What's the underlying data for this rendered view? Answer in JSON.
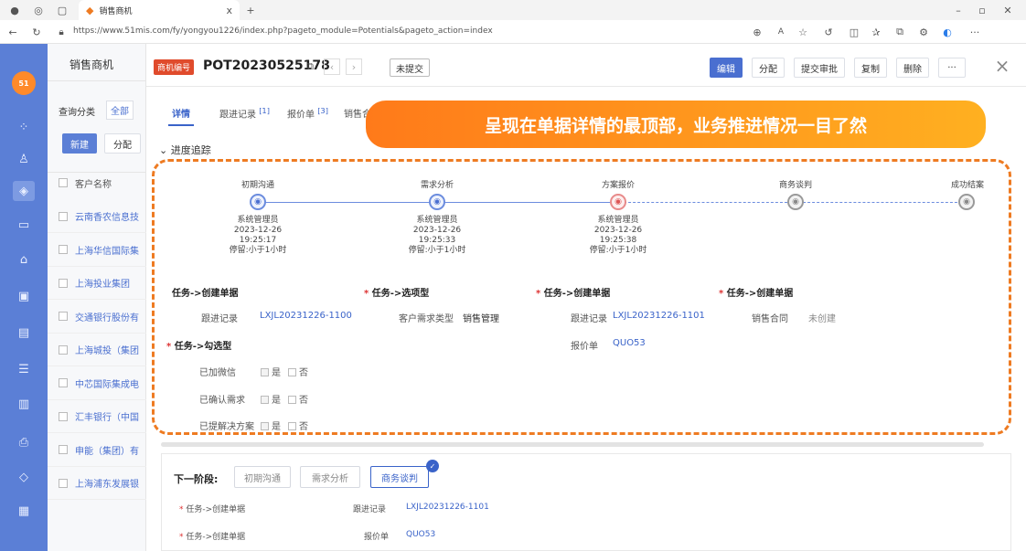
{
  "browser": {
    "tab_title": "销售商机",
    "tab_close": "x",
    "new_tab": "+",
    "url": "https://www.51mis.com/fy/yongyou1226/index.php?pageto_module=Potentials&pageto_action=index"
  },
  "sidebar_icons": [
    "app-logo-icon",
    "grid-icon",
    "users-icon",
    "target-icon",
    "folder-icon",
    "briefcase-icon",
    "bag-icon",
    "monitor-icon",
    "document-icon",
    "board-icon",
    "printer-icon",
    "bookmark-icon",
    "file-icon"
  ],
  "list": {
    "title": "销售商机",
    "filter_label": "查询分类",
    "filter_value": "全部",
    "new_label": "新建",
    "assign_label": "分配",
    "col_header": "客户名称",
    "rows": [
      "云南香农信息技",
      "上海华信国际集",
      "上海投业集团",
      "交通银行股份有",
      "上海城投（集团",
      "中芯国际集成电",
      "汇丰银行（中国",
      "申能（集团）有",
      "上海浦东发展银"
    ]
  },
  "header": {
    "badge": "商机编号",
    "record_id": "POT20230525178",
    "status": "未提交",
    "actions": [
      "编辑",
      "分配",
      "提交审批",
      "复制",
      "删除",
      "···"
    ],
    "close": "×"
  },
  "tabs": [
    {
      "label": "详情"
    },
    {
      "label": "跟进记录",
      "count": "[1]"
    },
    {
      "label": "报价单",
      "count": "[3]"
    },
    {
      "label": "销售合"
    }
  ],
  "callout": "呈现在单据详情的最顶部，业务推进情况一目了然",
  "progress": {
    "section_title": "进度追踪",
    "stages": [
      {
        "name": "初期沟通",
        "user": "系统管理员",
        "date": "2023-12-26",
        "time": "19:25:17",
        "dwell": "停留:小于1小时"
      },
      {
        "name": "需求分析",
        "user": "系统管理员",
        "date": "2023-12-26",
        "time": "19:25:33",
        "dwell": "停留:小于1小时"
      },
      {
        "name": "方案报价",
        "user": "系统管理员",
        "date": "2023-12-26",
        "time": "19:25:38",
        "dwell": "停留:小于1小时"
      },
      {
        "name": "商务谈判",
        "user": "",
        "date": "",
        "time": "",
        "dwell": ""
      },
      {
        "name": "成功结案",
        "user": "",
        "date": "",
        "time": "",
        "dwell": ""
      }
    ]
  },
  "tasks": {
    "t1": {
      "title": "任务->创建单据",
      "field": "跟进记录",
      "value": "LXJL20231226-1100"
    },
    "t2": {
      "title": "任务->选项型",
      "field": "客户需求类型",
      "value": "销售管理"
    },
    "t3": {
      "title": "任务->创建单据",
      "field": "跟进记录",
      "value": "LXJL20231226-1101",
      "field2": "报价单",
      "value2": "QUO53"
    },
    "t4": {
      "title": "任务->创建单据",
      "field": "销售合同",
      "value": "未创建"
    },
    "t5": {
      "title": "任务->勾选型",
      "items": [
        "已加微信",
        "已确认需求",
        "已提解决方案"
      ],
      "yes": "是",
      "no": "否"
    }
  },
  "next_stage": {
    "label": "下一阶段:",
    "options": [
      "初期沟通",
      "需求分析",
      "商务谈判"
    ],
    "rows": [
      {
        "task": "任务->创建单据",
        "field": "跟进记录",
        "value": "LXJL20231226-1101"
      },
      {
        "task": "任务->创建单据",
        "field": "报价单",
        "value": "QUO53"
      }
    ]
  }
}
